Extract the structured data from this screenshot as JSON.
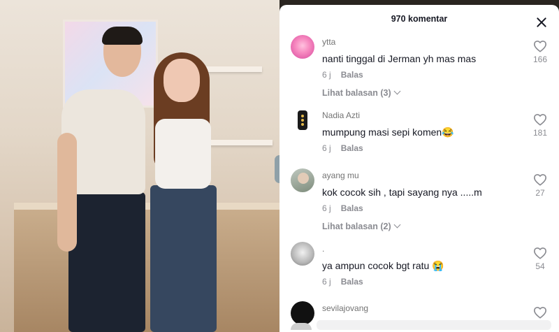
{
  "panel": {
    "title": "970 komentar"
  },
  "comments": [
    {
      "username": "ytta",
      "text": "nanti tinggal di Jerman yh mas mas",
      "time": "6 j",
      "reply_label": "Balas",
      "likes": "166",
      "view_replies": "Lihat balasan (3)"
    },
    {
      "username": "Nadia Azti",
      "text": "mumpung masi sepi komen😂",
      "time": "6 j",
      "reply_label": "Balas",
      "likes": "181"
    },
    {
      "username": "ayang mu",
      "text": "kok cocok sih , tapi sayang nya .....m",
      "time": "6 j",
      "reply_label": "Balas",
      "likes": "27",
      "view_replies": "Lihat balasan (2)"
    },
    {
      "username": ".",
      "text": "ya ampun cocok bgt ratu 😭",
      "time": "6 j",
      "reply_label": "Balas",
      "likes": "54"
    },
    {
      "username": "sevilajovang"
    }
  ],
  "colors": {
    "text_primary": "#161823",
    "text_secondary": "#8a8b91"
  },
  "icons": [
    "close-icon",
    "heart-icon",
    "chevron-down-icon"
  ]
}
